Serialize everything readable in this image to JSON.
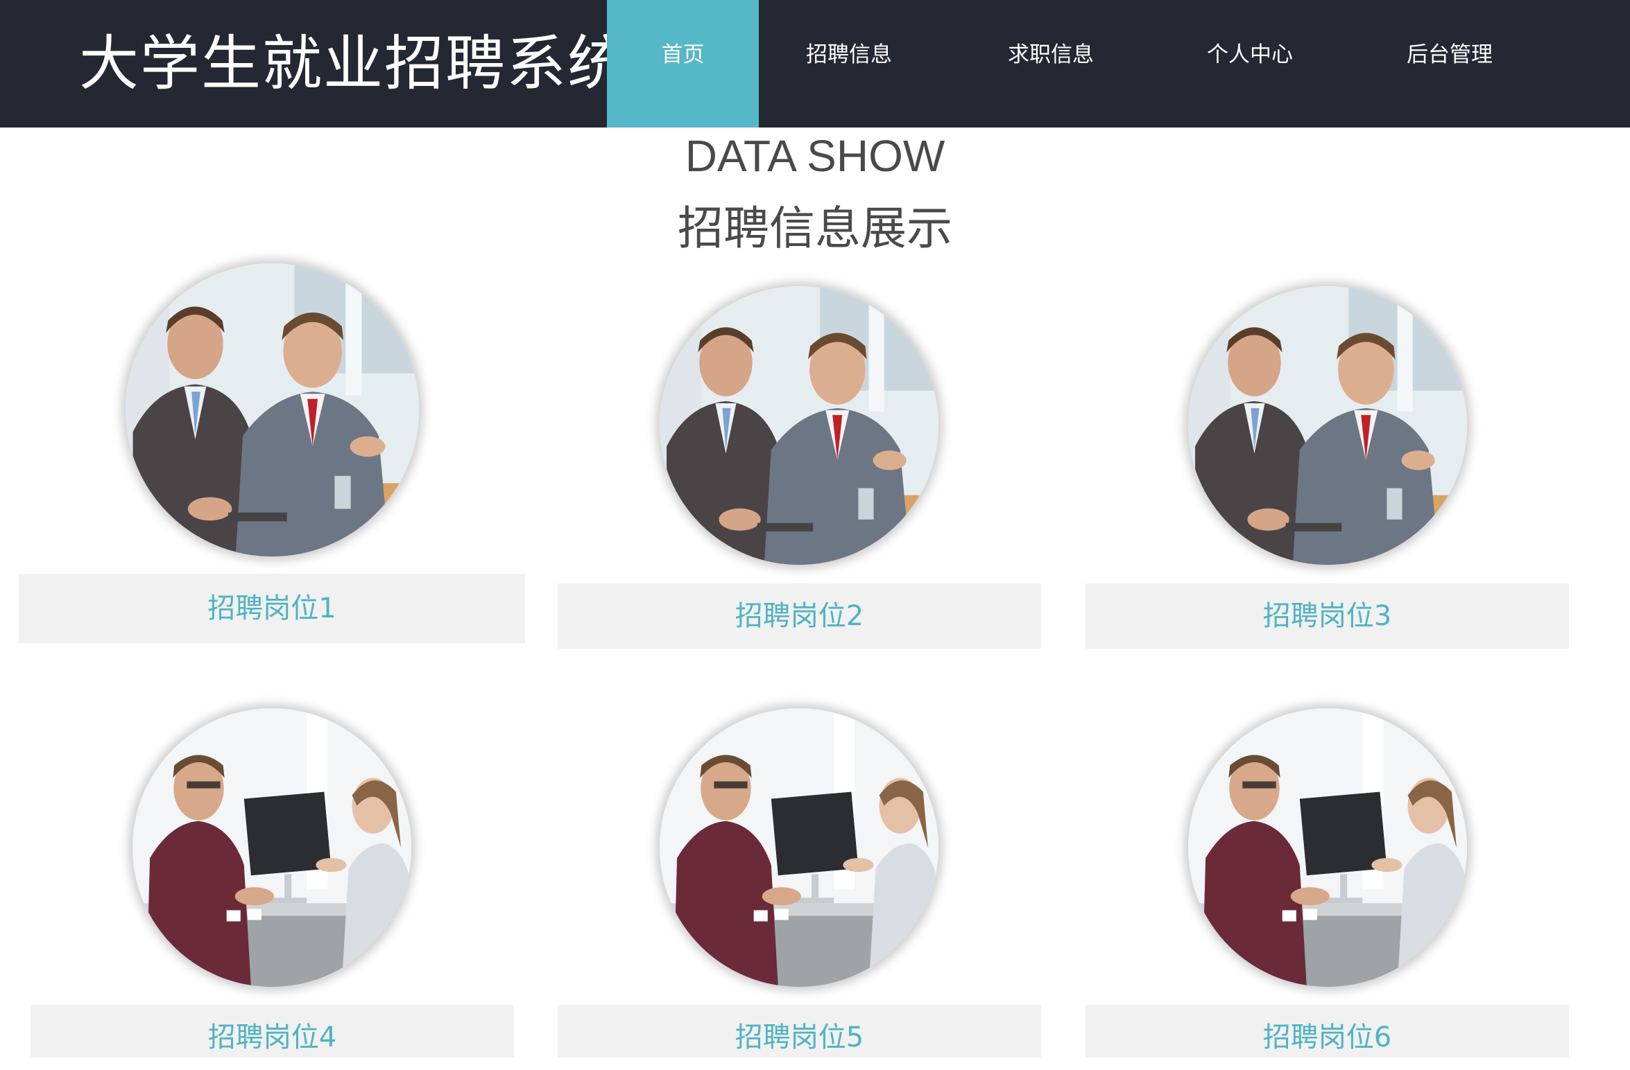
{
  "header": {
    "brand": "大学生就业招聘系统",
    "nav": [
      {
        "label": "首页",
        "active": true
      },
      {
        "label": "招聘信息",
        "active": false
      },
      {
        "label": "求职信息",
        "active": false
      },
      {
        "label": "个人中心",
        "active": false
      },
      {
        "label": "后台管理",
        "active": false
      }
    ]
  },
  "section": {
    "title_en": "DATA SHOW",
    "title_cn": "招聘信息展示"
  },
  "cards": [
    {
      "label": "招聘岗位1",
      "image": "business-meeting-photo"
    },
    {
      "label": "招聘岗位2",
      "image": "business-meeting-photo"
    },
    {
      "label": "招聘岗位3",
      "image": "business-meeting-photo"
    },
    {
      "label": "招聘岗位4",
      "image": "job-interview-photo"
    },
    {
      "label": "招聘岗位5",
      "image": "job-interview-photo"
    },
    {
      "label": "招聘岗位6",
      "image": "job-interview-photo"
    }
  ],
  "colors": {
    "header_bg": "#232833",
    "accent": "#55b7c8",
    "label_text": "#4fb3c4",
    "label_bg": "#f1f1f1"
  }
}
